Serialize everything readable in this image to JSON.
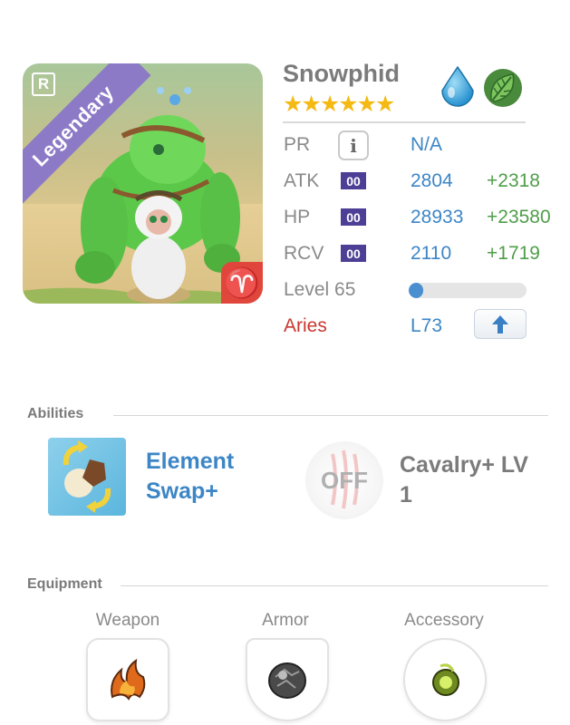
{
  "monster": {
    "name": "Snowphid",
    "stars": "★★★★★★",
    "rarity_badge": "R",
    "rarity_label": "Legendary",
    "zodiac_symbol": "♈",
    "elements": [
      "water-drop-icon",
      "leaf-icon"
    ]
  },
  "stats": {
    "pr": {
      "label": "PR",
      "value": "N/A"
    },
    "atk": {
      "label": "ATK",
      "plus": "00",
      "value": "2804",
      "bonus": "+2318"
    },
    "hp": {
      "label": "HP",
      "plus": "00",
      "value": "28933",
      "bonus": "+23580"
    },
    "rcv": {
      "label": "RCV",
      "plus": "00",
      "value": "2110",
      "bonus": "+1719"
    },
    "level": {
      "label": "Level 65",
      "progress": 0.12
    },
    "zodiac": {
      "label": "Aries",
      "value": "L73"
    }
  },
  "abilities": {
    "title": "Abilities",
    "items": [
      {
        "name": "Element Swap+",
        "icon": "element-swap-icon"
      },
      {
        "name": "Cavalry+ LV 1",
        "icon": "off-icon",
        "status": "OFF"
      }
    ]
  },
  "equipment": {
    "title": "Equipment",
    "slots": [
      {
        "label": "Weapon",
        "icon": "flame-claw-icon"
      },
      {
        "label": "Armor",
        "icon": "stone-armor-icon"
      },
      {
        "label": "Accessory",
        "icon": "green-orb-icon"
      }
    ]
  },
  "colors": {
    "accent_blue": "#3d86c6",
    "bonus_green": "#4f9e4a",
    "zodiac_red": "#c9372f",
    "legendary_purple": "#8d7ac7",
    "star_gold": "#f5b914"
  }
}
